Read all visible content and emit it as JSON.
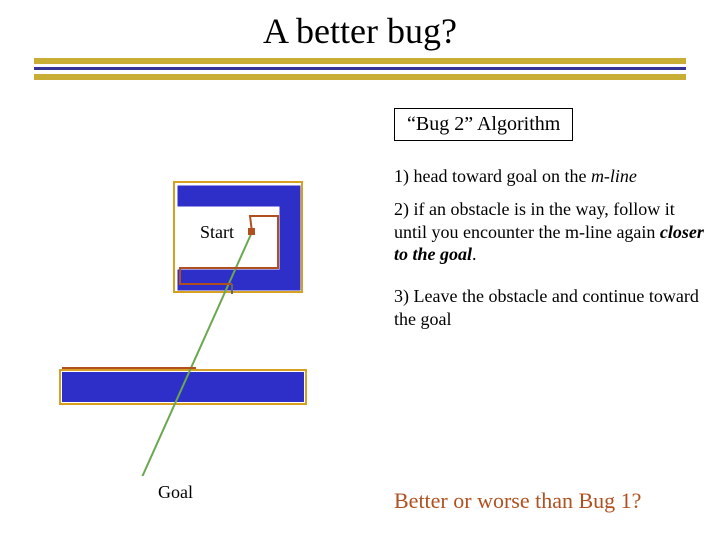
{
  "title": "A better bug?",
  "algobox": "“Bug 2” Algorithm",
  "steps": {
    "s1": {
      "pre": "1) head toward goal on the ",
      "it": "m-line"
    },
    "s2": {
      "pre": "2) if an obstacle is in the way, follow it until you encounter the m-line again ",
      "em": "closer to the goal",
      "post": "."
    },
    "s3": "3) Leave the obstacle and continue toward the goal"
  },
  "labels": {
    "start": "Start",
    "goal": "Goal"
  },
  "question": "Better or worse than Bug 1?"
}
